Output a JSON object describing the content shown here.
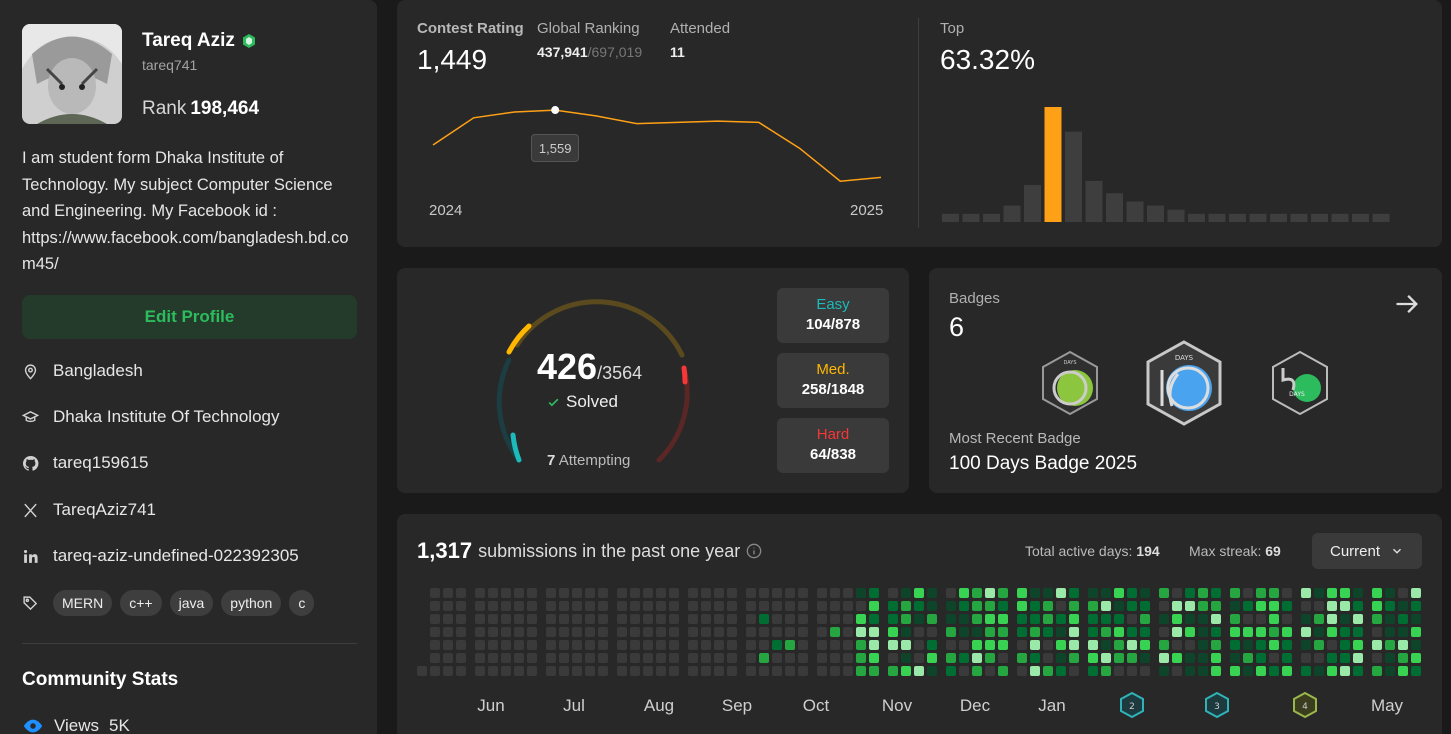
{
  "profile": {
    "name": "Tareq Aziz",
    "username": "tareq741",
    "rank_label": "Rank",
    "rank_value": "198,464",
    "bio": "I am student form Dhaka Institute of Technology. My subject Computer Science and Engineering. My Facebook id : https://www.facebook.com/bangladesh.bd.com45/",
    "edit_label": "Edit Profile",
    "location": "Bangladesh",
    "school": "Dhaka Institute Of Technology",
    "github": "tareq159615",
    "twitter": "TareqAziz741",
    "linkedin": "tareq-aziz-undefined-022392305",
    "skills": [
      "MERN",
      "c++",
      "java",
      "python",
      "c"
    ],
    "community_title": "Community Stats",
    "views_label": "Views",
    "views_value": "5K"
  },
  "contest": {
    "rating_label": "Contest Rating",
    "rating_value": "1,449",
    "global_label": "Global Ranking",
    "global_value": "437,941",
    "global_total": "/697,019",
    "attended_label": "Attended",
    "attended_value": "11",
    "tooltip": "1,559",
    "x_start": "2024",
    "x_end": "2025",
    "top_label": "Top",
    "top_value": "63.32%",
    "accent": "#ffa116"
  },
  "chart_data": {
    "type": "line",
    "title": "",
    "x": [
      0,
      1,
      2,
      3,
      4,
      5,
      6,
      7,
      8,
      9,
      10,
      11
    ],
    "values": [
      1505,
      1547,
      1556,
      1559,
      1550,
      1538,
      1540,
      1542,
      1540,
      1500,
      1449,
      1455
    ],
    "xlabel": "",
    "ylabel": "",
    "x_tick_labels": [
      "2024",
      "2025"
    ],
    "ylim": [
      1420,
      1590
    ],
    "grid": false,
    "highlight_index": 3,
    "distribution": {
      "type": "bar",
      "values": [
        2,
        2,
        2,
        4,
        9,
        28,
        22,
        10,
        7,
        5,
        4,
        3,
        2,
        2,
        2,
        2,
        2,
        2,
        2,
        2,
        2,
        2
      ],
      "highlight_index": 5
    }
  },
  "solved": {
    "count": "426",
    "total": "/3564",
    "solved_label": "Solved",
    "attempting_count": "7",
    "attempting_label": "Attempting",
    "easy_label": "Easy",
    "easy_value": "104/878",
    "medium_label": "Med.",
    "medium_value": "258/1848",
    "hard_label": "Hard",
    "hard_value": "64/838",
    "easy_color": "#1cbaba",
    "medium_color": "#ffb700",
    "hard_color": "#f63737"
  },
  "badges": {
    "label": "Badges",
    "count": "6",
    "recent_label": "Most Recent Badge",
    "recent_value": "100 Days Badge 2025",
    "badge_texts": [
      "DAYS",
      "DAYS",
      "DAYS"
    ]
  },
  "submissions": {
    "count": "1,317",
    "label": "submissions in the past one year",
    "active_label": "Total active days:",
    "active_value": "194",
    "streak_label": "Max streak:",
    "streak_value": "69",
    "dropdown_value": "Current",
    "months": [
      "Jun",
      "Jul",
      "Aug",
      "Sep",
      "Oct",
      "Nov",
      "Dec",
      "Jan",
      "May"
    ],
    "mini_badges": [
      "2",
      "3",
      "4"
    ]
  }
}
